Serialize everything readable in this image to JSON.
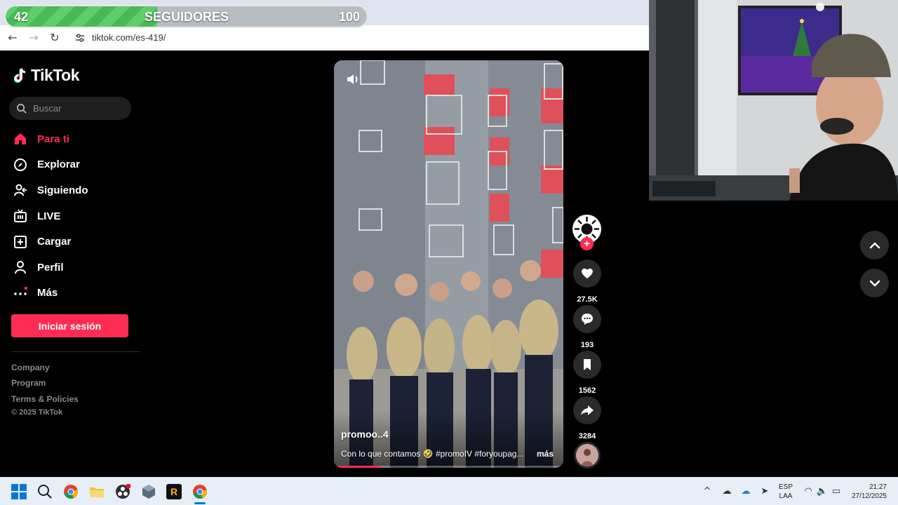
{
  "browser": {
    "url": "tiktok.com/es-419/"
  },
  "follower_goal": {
    "current": "42",
    "label": "SEGUIDORES",
    "goal": "100",
    "progress": 0.42
  },
  "tiktok": {
    "logo": "TikTok",
    "search_placeholder": "Buscar",
    "nav": [
      {
        "label": "Para ti",
        "icon": "home-icon",
        "active": true
      },
      {
        "label": "Explorar",
        "icon": "compass-icon"
      },
      {
        "label": "Siguiendo",
        "icon": "following-icon"
      },
      {
        "label": "LIVE",
        "icon": "live-icon"
      },
      {
        "label": "Cargar",
        "icon": "upload-icon"
      },
      {
        "label": "Perfil",
        "icon": "profile-icon"
      },
      {
        "label": "Más",
        "icon": "more-icon"
      }
    ],
    "login_label": "Iniciar sesión",
    "footer": {
      "company": "Company",
      "program": "Program",
      "terms": "Terms & Policies",
      "copyright": "© 2025 TikTok"
    },
    "accent_color": "#fe2c55"
  },
  "video": {
    "author": "promoo..4",
    "caption": "Con lo que contamos 🤣 #promoIV #foryoupag...",
    "more": "más",
    "progress": 0.2,
    "likes": "27.5K",
    "comments": "193",
    "saves": "1562",
    "shares": "3284"
  },
  "taskbar": {
    "lang_top": "ESP",
    "lang_bottom": "LAA",
    "time": "21:27",
    "date": "27/12/2025"
  }
}
